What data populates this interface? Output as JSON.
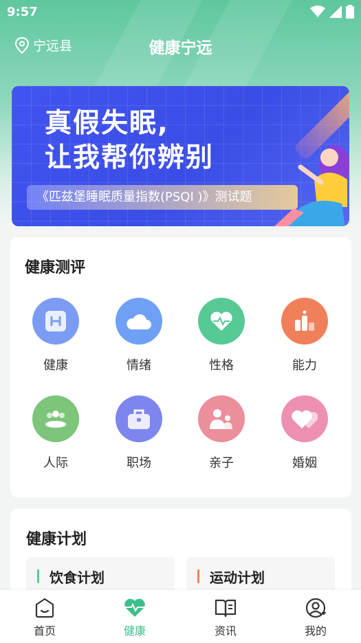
{
  "status_bar": {
    "time": "9:57"
  },
  "header": {
    "location": "宁远县",
    "title": "健康宁远"
  },
  "banner": {
    "headline_line1": "真假失眠,",
    "headline_line2": "让我帮你辨别",
    "subtitle": "《匹兹堡睡眠质量指数(PSQI )》测试题"
  },
  "assessment": {
    "title": "健康测评",
    "items": [
      {
        "label": "健康",
        "icon": "health-h-icon",
        "color": "#7b9cf2"
      },
      {
        "label": "情绪",
        "icon": "cloud-icon",
        "color": "#6fa0f5"
      },
      {
        "label": "性格",
        "icon": "heart-pulse-icon",
        "color": "#56c994"
      },
      {
        "label": "能力",
        "icon": "bar-chart-icon",
        "color": "#f0805a"
      },
      {
        "label": "人际",
        "icon": "people-icon",
        "color": "#7cc57a"
      },
      {
        "label": "职场",
        "icon": "briefcase-icon",
        "color": "#7c86ee"
      },
      {
        "label": "亲子",
        "icon": "parent-child-icon",
        "color": "#ec8e9b"
      },
      {
        "label": "婚姻",
        "icon": "hearts-icon",
        "color": "#ee8fb4"
      }
    ]
  },
  "plan": {
    "title": "健康计划",
    "items": [
      {
        "label": "饮食计划",
        "accent": "#56c994"
      },
      {
        "label": "运动计划",
        "accent": "#f0805a"
      }
    ]
  },
  "tabbar": {
    "tabs": [
      {
        "label": "首页",
        "icon": "home-icon"
      },
      {
        "label": "健康",
        "icon": "heart-pulse-icon"
      },
      {
        "label": "资讯",
        "icon": "book-icon"
      },
      {
        "label": "我的",
        "icon": "user-icon"
      }
    ],
    "active_index": 1,
    "active_color": "#3bbf8b"
  }
}
